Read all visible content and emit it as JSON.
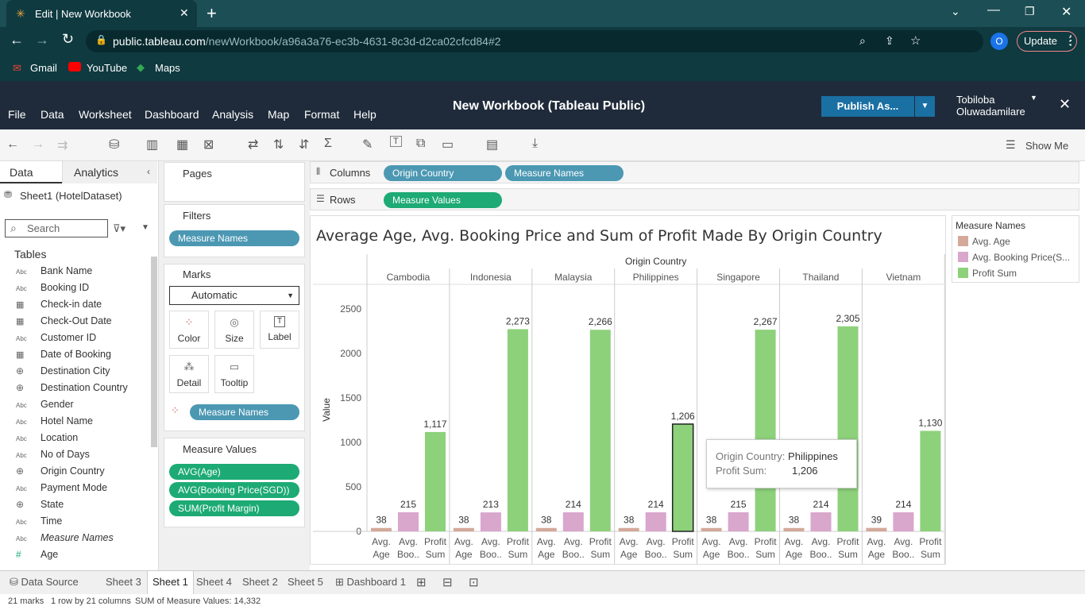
{
  "browser": {
    "tab_title": "Edit | New Workbook",
    "url_host": "public.tableau.com",
    "url_path": "/newWorkbook/a96a3a76-ec3b-4631-8c3d-d2ca02cfcd84#2",
    "profile_initial": "O",
    "update_label": "Update",
    "bookmarks": [
      "Gmail",
      "YouTube",
      "Maps"
    ]
  },
  "app": {
    "menu": [
      "File",
      "Data",
      "Worksheet",
      "Dashboard",
      "Analysis",
      "Map",
      "Format",
      "Help"
    ],
    "title": "New Workbook (Tableau Public)",
    "publish_label": "Publish As...",
    "user_first": "Tobiloba",
    "user_last": "Oluwadamilare",
    "show_me": "Show Me"
  },
  "data_pane": {
    "tab_data": "Data",
    "tab_analytics": "Analytics",
    "source": "Sheet1 (HotelDataset)",
    "search_placeholder": "Search",
    "tables_label": "Tables",
    "fields": [
      {
        "type": "Abc",
        "name": "Bank Name"
      },
      {
        "type": "Abc",
        "name": "Booking ID"
      },
      {
        "type": "date",
        "name": "Check-in date"
      },
      {
        "type": "date",
        "name": "Check-Out Date"
      },
      {
        "type": "Abc",
        "name": "Customer ID"
      },
      {
        "type": "date",
        "name": "Date of Booking"
      },
      {
        "type": "geo",
        "name": "Destination City"
      },
      {
        "type": "geo",
        "name": "Destination Country"
      },
      {
        "type": "Abc",
        "name": "Gender"
      },
      {
        "type": "Abc",
        "name": "Hotel Name"
      },
      {
        "type": "Abc",
        "name": "Location"
      },
      {
        "type": "Abc",
        "name": "No of Days"
      },
      {
        "type": "geo",
        "name": "Origin Country"
      },
      {
        "type": "Abc",
        "name": "Payment Mode"
      },
      {
        "type": "geo",
        "name": "State"
      },
      {
        "type": "Abc",
        "name": "Time"
      },
      {
        "type": "Abc",
        "name": "Measure Names"
      },
      {
        "type": "#",
        "name": "Age"
      }
    ]
  },
  "shelves": {
    "pages_label": "Pages",
    "filters_label": "Filters",
    "filter_pill": "Measure Names",
    "marks_label": "Marks",
    "mark_type": "Automatic",
    "mark_buttons": [
      "Color",
      "Size",
      "Label",
      "Detail",
      "Tooltip"
    ],
    "marks_pill": "Measure Names",
    "measure_values_label": "Measure Values",
    "measure_pills": [
      "AVG(Age)",
      "AVG(Booking Price(SGD))",
      "SUM(Profit Margin)"
    ],
    "columns_label": "Columns",
    "columns_pills": [
      "Origin Country",
      "Measure Names"
    ],
    "rows_label": "Rows",
    "rows_pills": [
      "Measure Values"
    ]
  },
  "legend": {
    "title": "Measure Names",
    "items": [
      {
        "label": "Avg. Age",
        "color": "#d4a99a"
      },
      {
        "label": "Avg. Booking Price(S...",
        "color": "#d9a6cc"
      },
      {
        "label": "Profit Sum",
        "color": "#8dd17b"
      }
    ]
  },
  "tooltip": {
    "k1": "Origin Country:",
    "v1": "Philippines",
    "k2": "Profit Sum:",
    "v2": "1,206"
  },
  "chart_data": {
    "type": "bar",
    "title": "Average Age, Avg. Booking Price and Sum of Profit Made By Origin Country",
    "header": "Origin Country",
    "ylabel": "Value",
    "ylim": [
      0,
      2500
    ],
    "yticks": [
      0,
      500,
      1000,
      1500,
      2000,
      2500
    ],
    "categories": [
      "Cambodia",
      "Indonesia",
      "Malaysia",
      "Philippines",
      "Singapore",
      "Thailand",
      "Vietnam"
    ],
    "sub_labels": [
      [
        "Avg.",
        "Age"
      ],
      [
        "Avg.",
        "Boo.."
      ],
      [
        "Profit",
        "Sum"
      ]
    ],
    "series": [
      {
        "name": "Avg. Age",
        "color": "#d4a99a",
        "values": [
          38,
          38,
          38,
          38,
          38,
          38,
          39
        ],
        "labels": [
          "38",
          "38",
          "38",
          "38",
          "38",
          "38",
          "39"
        ]
      },
      {
        "name": "Avg. Booking Price(SGD)",
        "color": "#d9a6cc",
        "values": [
          215,
          213,
          214,
          214,
          215,
          214,
          214
        ],
        "labels": [
          "215",
          "213",
          "214",
          "214",
          "215",
          "214",
          "214"
        ]
      },
      {
        "name": "Profit Sum",
        "color": "#8dd17b",
        "values": [
          1117,
          2273,
          2266,
          1206,
          2267,
          2305,
          1130
        ],
        "labels": [
          "1,117",
          "2,273",
          "2,266",
          "1,206",
          "2,267",
          "2,305",
          "1,130"
        ]
      }
    ],
    "highlighted": {
      "category": "Philippines",
      "series": "Profit Sum"
    }
  },
  "sheet_tabs": [
    "Data Source",
    "Sheet 3",
    "Sheet 1",
    "Sheet 4",
    "Sheet 2",
    "Sheet 5",
    "Dashboard 1"
  ],
  "active_tab": "Sheet 1",
  "status": {
    "marks": "21 marks",
    "dims": "1 row by 21 columns",
    "sum": "SUM of Measure Values: 14,332"
  }
}
